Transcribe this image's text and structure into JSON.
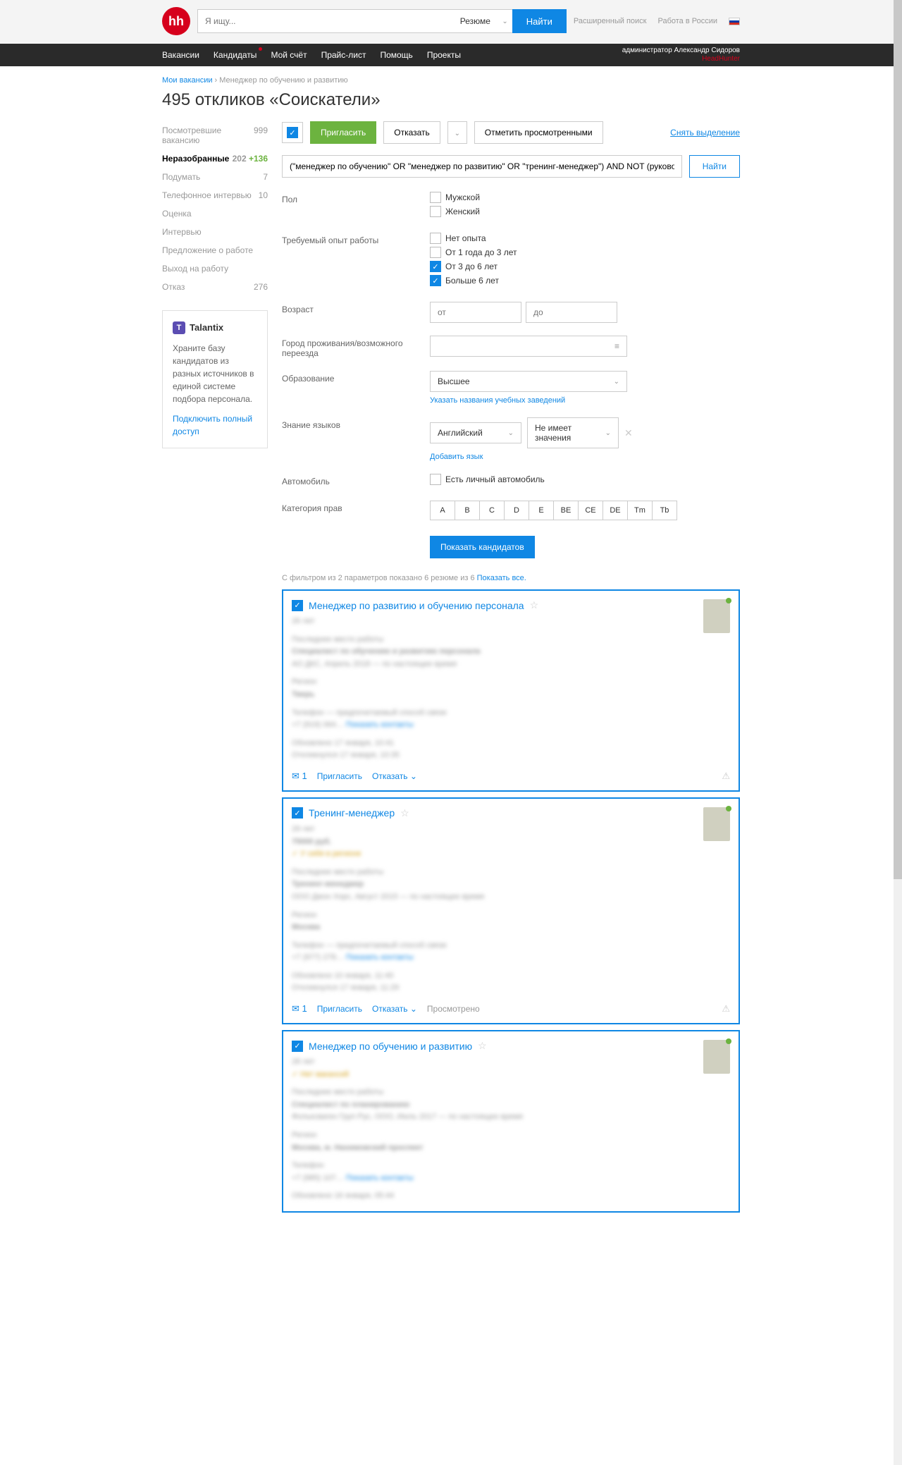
{
  "search": {
    "placeholder": "Я ищу...",
    "type": "Резюме",
    "button": "Найти"
  },
  "top_links": {
    "advanced": "Расширенный поиск",
    "work_in": "Работа в России"
  },
  "nav": {
    "items": [
      "Вакансии",
      "Кандидаты",
      "Мой счёт",
      "Прайс-лист",
      "Помощь",
      "Проекты"
    ],
    "user_role": "администратор",
    "user_name": "Александр Сидоров",
    "company": "HeadHunter"
  },
  "breadcrumb": {
    "a": "Мои вакансии",
    "b": "Менеджер по обучению и развитию"
  },
  "title": "495 откликов «Соискатели»",
  "sidebar": [
    {
      "label": "Посмотревшие вакансию",
      "count": "999"
    },
    {
      "label": "Неразобранные",
      "count": "202",
      "new": "+136",
      "active": true
    },
    {
      "label": "Подумать",
      "count": "7"
    },
    {
      "label": "Телефонное интервью",
      "count": "10"
    },
    {
      "label": "Оценка",
      "count": ""
    },
    {
      "label": "Интервью",
      "count": ""
    },
    {
      "label": "Предложение о работе",
      "count": ""
    },
    {
      "label": "Выход на работу",
      "count": ""
    },
    {
      "label": "Отказ",
      "count": "276"
    }
  ],
  "promo": {
    "brand": "Talantix",
    "text": "Храните базу кандидатов из разных источников в единой системе подбора персонала.",
    "link": "Подключить полный доступ"
  },
  "actions": {
    "invite": "Пригласить",
    "reject": "Отказать",
    "mark_viewed": "Отметить просмотренными",
    "deselect": "Снять выделение"
  },
  "query": "(\"менеджер по обучению\" OR \"менеджер по развитию\" OR \"тренинг-менеджер\") AND NOT (руководитель OR психолог OR преподавате",
  "query_btn": "Найти",
  "filters": {
    "gender": {
      "label": "Пол",
      "male": "Мужской",
      "female": "Женский"
    },
    "exp": {
      "label": "Требуемый опыт работы",
      "none": "Нет опыта",
      "y1_3": "От 1 года до 3 лет",
      "y3_6": "От 3 до 6 лет",
      "y6": "Больше 6 лет"
    },
    "age": {
      "label": "Возраст",
      "from": "от",
      "to": "до"
    },
    "city": {
      "label": "Город проживания/возможного переезда"
    },
    "edu": {
      "label": "Образование",
      "value": "Высшее",
      "sublink": "Указать названия учебных заведений"
    },
    "lang": {
      "label": "Знание языков",
      "value": "Английский",
      "level": "Не имеет значения",
      "add": "Добавить язык"
    },
    "car": {
      "label": "Автомобиль",
      "has": "Есть личный автомобиль"
    },
    "license": {
      "label": "Категория прав",
      "cats": [
        "A",
        "B",
        "C",
        "D",
        "E",
        "BE",
        "CE",
        "DE",
        "Tm",
        "Tb"
      ]
    },
    "show": "Показать кандидатов"
  },
  "results_note": {
    "prefix": "С фильтром из 2 параметров показано 6 резюме из 6 ",
    "link": "Показать все."
  },
  "cards": [
    {
      "title": "Менеджер по развитию и обучению персонала",
      "age": "26 лет",
      "job": "Специалист по обучению и развитию персонала",
      "company": "АО ДКС, Апрель 2018 — по настоящее время",
      "region": "Регион",
      "city": "Тверь",
      "phone_label": "Телефон — предпочитаемый способ связи",
      "phone": "+7 (919) 064…",
      "contacts": "Показать контакты",
      "updated": "Обновлено 17 января, 10:41",
      "responded": "Откликнулся 17 января, 10:35",
      "msg_count": "1",
      "actions": [
        "Пригласить",
        "Отказать"
      ]
    },
    {
      "title": "Тренинг-менеджер",
      "age": "29 лет",
      "salary": "75000 руб.",
      "badge": "У себя в регионе",
      "job": "Тренинг-менеджер",
      "company": "ООО Джон Хорс, Август 2015 — по настоящее время",
      "region": "Регион",
      "city": "Москва",
      "phone_label": "Телефон — предпочитаемый способ связи",
      "phone": "+7 (977) 278…",
      "contacts": "Показать контакты",
      "updated": "Обновлено 10 января, 11:40",
      "responded": "Откликнулся 17 января, 11:29",
      "msg_count": "1",
      "actions": [
        "Пригласить",
        "Отказать"
      ],
      "viewed": "Просмотрено"
    },
    {
      "title": "Менеджер по обучению и развитию",
      "age": "28 лет",
      "badge": "Нет вакансий",
      "job": "Специалист по планированию",
      "company": "Фольксваген Груп Рус, ООО, Июль 2017 — по настоящее время",
      "region": "Регион",
      "city": "Москва, м. Нахимовский проспект",
      "phone_label": "Телефон",
      "phone": "+7 (985) 107…",
      "contacts": "Показать контакты",
      "updated": "Обновлено 16 января, 05:44"
    }
  ]
}
